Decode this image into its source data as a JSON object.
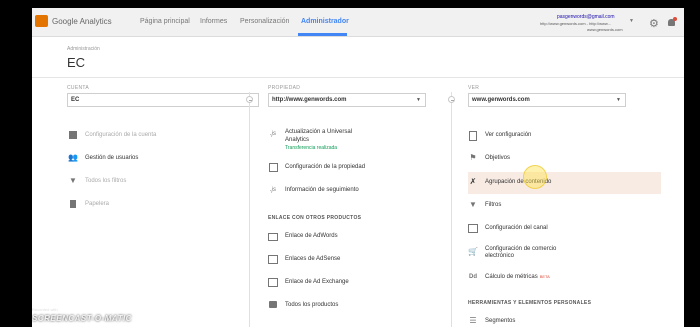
{
  "brand": {
    "name": "Google Analytics",
    "color": "#e37400"
  },
  "nav": {
    "items": [
      "Página principal",
      "Informes",
      "Personalización",
      "Administrador"
    ],
    "active": "Administrador"
  },
  "account": {
    "email": "pasgenwords@gmail.com",
    "line1": "http://www.genwords.com - http://www...",
    "line2": "www.genwords.com"
  },
  "header": {
    "breadcrumb": "Administración",
    "title": "EC"
  },
  "columns": {
    "cuenta": {
      "label": "CUENTA",
      "selected": "EC",
      "items": [
        {
          "icon": "building-icon",
          "label": "Configuración de la cuenta",
          "disabled": true
        },
        {
          "icon": "users-icon",
          "label": "Gestión de usuarios",
          "disabled": false
        },
        {
          "icon": "filter-icon",
          "label": "Todos los filtros",
          "disabled": true
        },
        {
          "icon": "trash-icon",
          "label": "Papelera",
          "disabled": true
        }
      ]
    },
    "propiedad": {
      "label": "PROPIEDAD",
      "selected": "http://www.genwords.com",
      "items": [
        {
          "icon": "js-icon",
          "label_line1": "Actualización a Universal",
          "label_line2": "Analytics",
          "status": "Transferencia realizada"
        },
        {
          "icon": "property-settings-icon",
          "label": "Configuración de la propiedad"
        },
        {
          "icon": "js-icon",
          "label": "Información de seguimiento"
        }
      ],
      "section": "ENLACE CON OTROS PRODUCTOS",
      "products": [
        {
          "icon": "adwords-icon",
          "label": "Enlace de AdWords"
        },
        {
          "icon": "adsense-icon",
          "label": "Enlaces de AdSense"
        },
        {
          "icon": "adexchange-icon",
          "label": "Enlace de Ad Exchange"
        },
        {
          "icon": "all-products-icon",
          "label": "Todos los productos"
        }
      ]
    },
    "ver": {
      "label": "VER",
      "selected": "www.genwords.com",
      "items": [
        {
          "icon": "document-icon",
          "label": "Ver configuración"
        },
        {
          "icon": "flag-icon",
          "label": "Objetivos"
        },
        {
          "icon": "person-icon",
          "label": "Agrupación de contenido"
        },
        {
          "icon": "filter-icon",
          "label": "Filtros"
        },
        {
          "icon": "channel-settings-icon",
          "label": "Configuración del canal"
        },
        {
          "icon": "cart-icon",
          "label_line1": "Configuración de comercio",
          "label_line2": "electrónico"
        },
        {
          "icon": "calculated-metrics-icon",
          "label": "Cálculo de métricas",
          "badge": "BETA",
          "icon_text": "Dd"
        }
      ],
      "section": "HERRAMIENTAS Y ELEMENTOS PERSONALES",
      "tools": [
        {
          "icon": "segments-icon",
          "label": "Segmentos"
        }
      ]
    }
  },
  "watermark": {
    "line1": "Recorded with",
    "brand": "SCREENCAST-O-MATIC"
  },
  "colors": {
    "accent": "#4285f4",
    "highlight": "#f7ebe4",
    "success": "#0f9d58",
    "beta": "#dd4b39"
  }
}
